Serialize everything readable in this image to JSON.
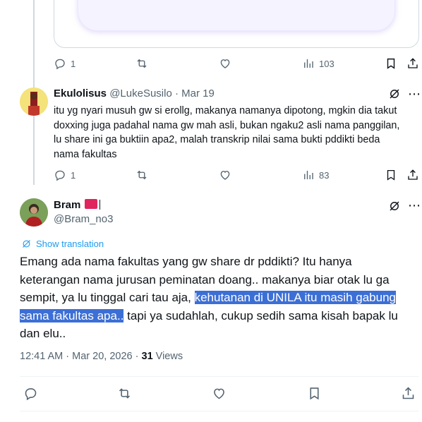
{
  "prev_tweet": {
    "actions": {
      "replies": "1",
      "reposts": "",
      "likes": "",
      "views": "103"
    }
  },
  "reply_tweet": {
    "display_name": "Ekulolisus",
    "handle": "@LukeSusilo",
    "separator": "·",
    "date": "Mar 19",
    "text": "itu yg nyari musuh gw si erollg, makanya namanya dipotong, mgkin dia takut doxxing juga padahal nama gw mah asli, bukan ngaku2 asli nama panggilan, lu share ini ga buktiin apa2, malah transkrip nilai sama bukti pddikti beda nama fakultas",
    "actions": {
      "replies": "1",
      "reposts": "",
      "likes": "",
      "views": "83"
    }
  },
  "main_tweet": {
    "display_name": "Bram",
    "handle": "@Bram_no3",
    "show_translation": "Show translation",
    "text_before": "Emang ada nama fakultas yang gw share dr pddikti? Itu hanya keterangan nama jurusan peminatan doang.. makanya biar otak lu ga sempit, ya lu tinggal cari tau aja, ",
    "text_highlight": "kehutanan di UNILA itu masih gabung sama fakultas apa..",
    "text_after": " tapi ya sudahlah, cukup sedih sama kisah bapak lu dan elu..",
    "time": "12:41 AM",
    "date": "Mar 20, 2026",
    "views_count": "31",
    "views_label": "Views"
  },
  "colors": {
    "accent": "#1d9bf0",
    "muted": "#536471",
    "highlight": "#3c6fd6",
    "badge": "#e0245e"
  },
  "icons": [
    "reply-icon",
    "repost-icon",
    "like-icon",
    "views-icon",
    "bookmark-icon",
    "share-icon",
    "grok-icon",
    "translate-icon"
  ]
}
